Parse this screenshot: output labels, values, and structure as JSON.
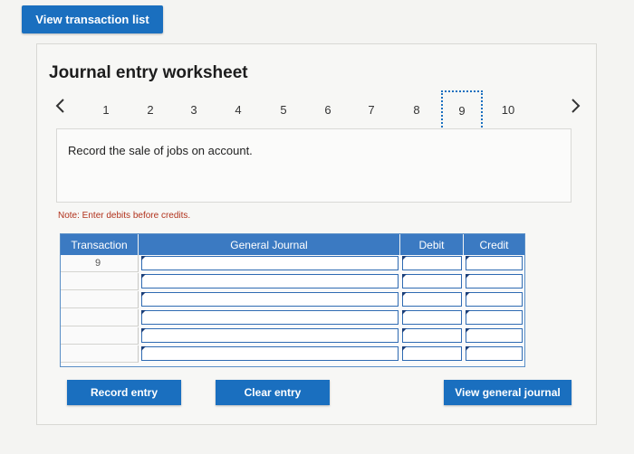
{
  "header": {
    "view_transactions_label": "View transaction list"
  },
  "worksheet": {
    "title": "Journal entry worksheet",
    "pages": [
      "1",
      "2",
      "3",
      "4",
      "5",
      "6",
      "7",
      "8",
      "9",
      "10"
    ],
    "current_page": "9",
    "prompt": "Record the sale of jobs on account.",
    "note": "Note: Enter debits before credits."
  },
  "table": {
    "headers": {
      "transaction": "Transaction",
      "general_journal": "General Journal",
      "debit": "Debit",
      "credit": "Credit"
    },
    "rows": [
      {
        "transaction": "9",
        "account": "",
        "debit": "",
        "credit": ""
      },
      {
        "transaction": "",
        "account": "",
        "debit": "",
        "credit": ""
      },
      {
        "transaction": "",
        "account": "",
        "debit": "",
        "credit": ""
      },
      {
        "transaction": "",
        "account": "",
        "debit": "",
        "credit": ""
      },
      {
        "transaction": "",
        "account": "",
        "debit": "",
        "credit": ""
      },
      {
        "transaction": "",
        "account": "",
        "debit": "",
        "credit": ""
      }
    ]
  },
  "buttons": {
    "record_entry": "Record entry",
    "clear_entry": "Clear entry",
    "view_general_journal": "View general journal"
  },
  "colors": {
    "accent": "#1a6fbf",
    "header_blue": "#3b7ac2",
    "note_red": "#b1321c"
  },
  "icons": {
    "prev": "chevron-left-icon",
    "next": "chevron-right-icon"
  }
}
